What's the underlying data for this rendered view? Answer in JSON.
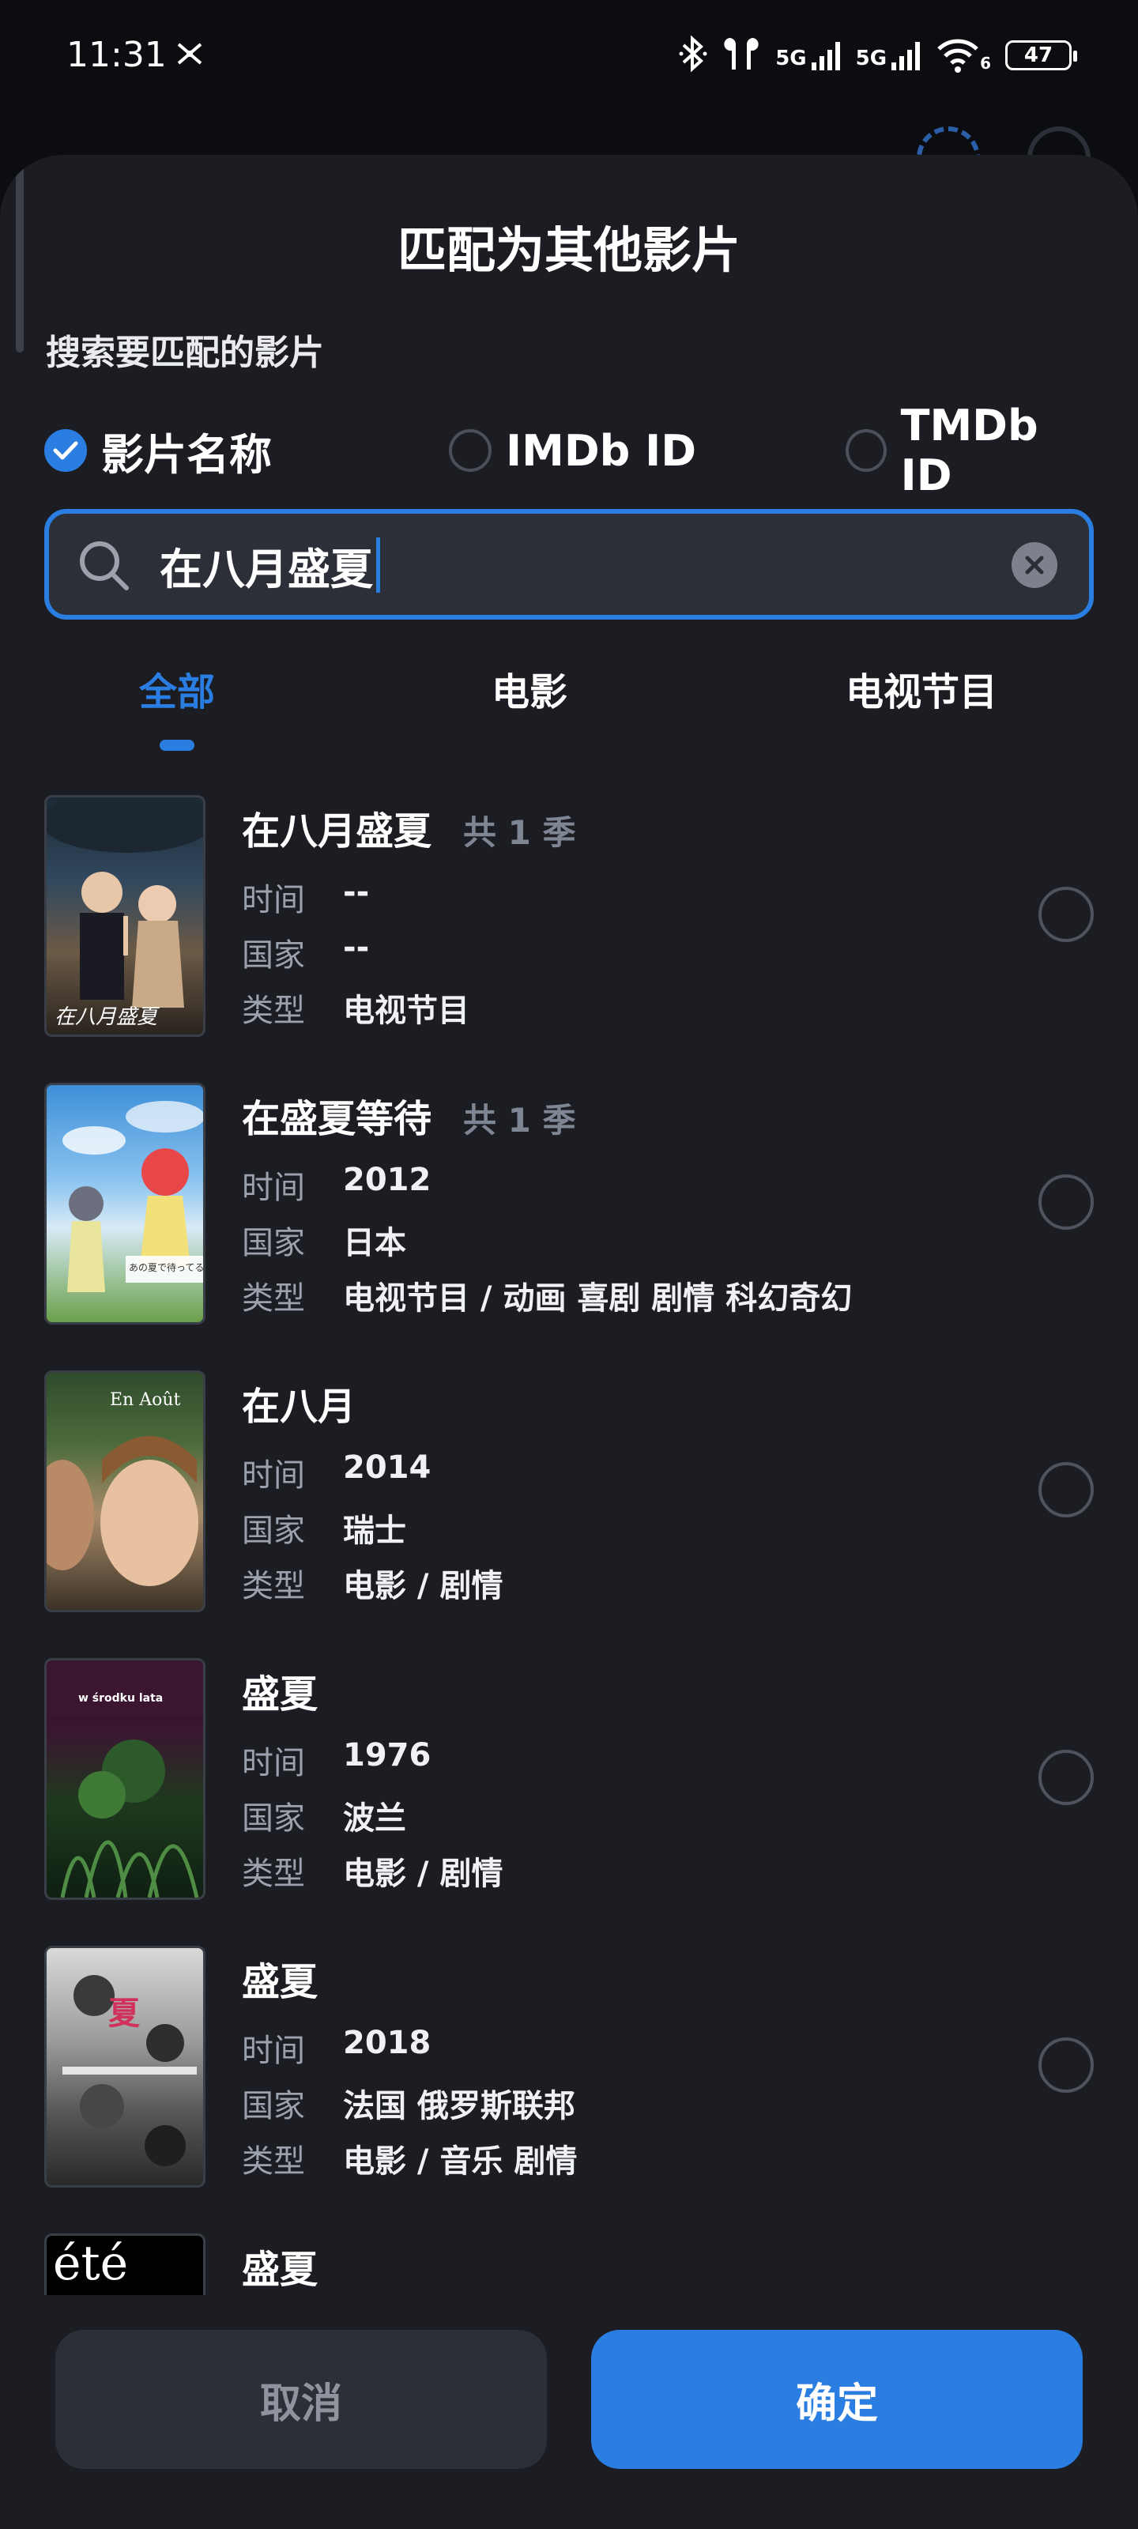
{
  "status": {
    "time": "11:31",
    "signal1": "5G",
    "signal2": "5G",
    "wifi_sub": "6",
    "battery": "47"
  },
  "sheet": {
    "title": "匹配为其他影片",
    "subtitle": "搜索要匹配的影片"
  },
  "search_type": {
    "options": [
      {
        "label": "影片名称",
        "checked": true
      },
      {
        "label": "IMDb ID",
        "checked": false
      },
      {
        "label": "TMDb ID",
        "checked": false
      }
    ]
  },
  "search": {
    "value": "在八月盛夏"
  },
  "tabs": [
    {
      "label": "全部",
      "active": true
    },
    {
      "label": "电影",
      "active": false
    },
    {
      "label": "电视节目",
      "active": false
    }
  ],
  "labels": {
    "time": "时间",
    "country": "国家",
    "genre": "类型"
  },
  "results": [
    {
      "title": "在八月盛夏",
      "season": "共 1 季",
      "time": "--",
      "country": "--",
      "genre": "电视节目",
      "poster_text": "在八月盛夏"
    },
    {
      "title": "在盛夏等待",
      "season": "共 1 季",
      "time": "2012",
      "country": "日本",
      "genre": "电视节目 / 动画  喜剧  剧情  科幻奇幻",
      "poster_text": "あの夏で待ってる"
    },
    {
      "title": "在八月",
      "season": "",
      "time": "2014",
      "country": "瑞士",
      "genre": "电影 / 剧情",
      "poster_text": "En Août"
    },
    {
      "title": "盛夏",
      "season": "",
      "time": "1976",
      "country": "波兰",
      "genre": "电影 / 剧情",
      "poster_text": "w środku lata"
    },
    {
      "title": "盛夏",
      "season": "",
      "time": "2018",
      "country": "法国  俄罗斯联邦",
      "genre": "电影 / 音乐  剧情",
      "poster_text": "夏"
    },
    {
      "title": "盛夏",
      "season": "",
      "time": "",
      "country": "",
      "genre": "",
      "poster_text": "été"
    }
  ],
  "buttons": {
    "cancel": "取消",
    "confirm": "确定"
  },
  "colors": {
    "accent": "#2a7de1",
    "sheet_bg": "#1b1d23",
    "page_bg": "#0c0d10"
  }
}
